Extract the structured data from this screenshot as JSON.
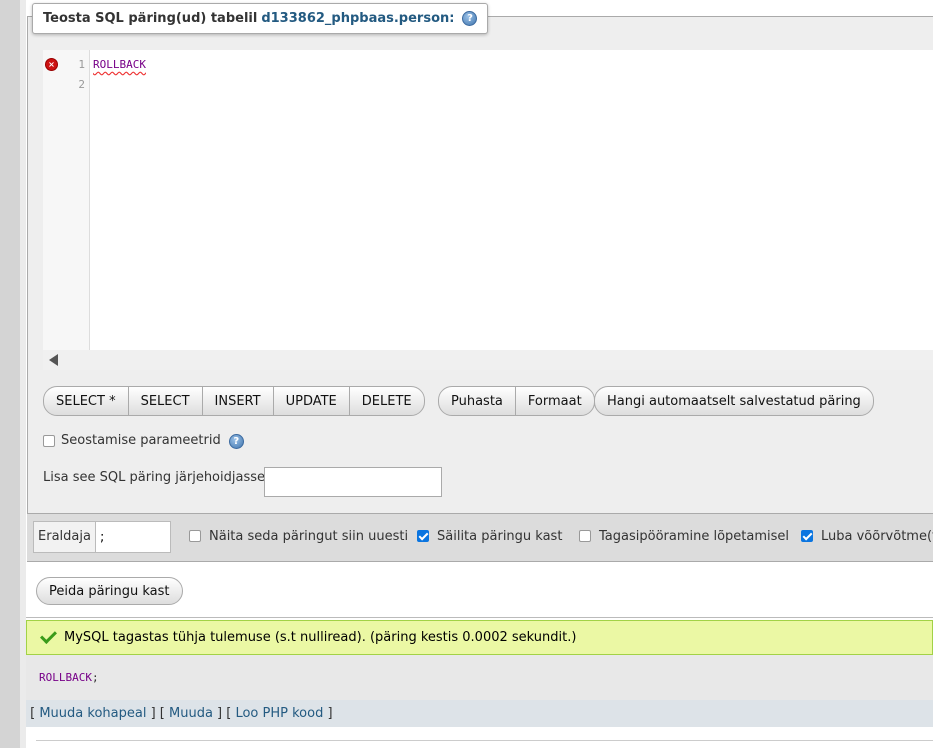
{
  "legend": {
    "prefix": "Teosta SQL päring(ud) tabelil",
    "table": "d133862_phpbaas.person:",
    "help": "?"
  },
  "editor": {
    "line_numbers": [
      "1",
      "2"
    ],
    "code": "ROLLBACK",
    "error_marker": "×"
  },
  "buttons": {
    "group1": [
      "SELECT *",
      "SELECT",
      "INSERT",
      "UPDATE",
      "DELETE"
    ],
    "group2": [
      "Puhasta",
      "Formaat"
    ],
    "autoload": "Hangi automaatselt salvestatud päring"
  },
  "bind_params": {
    "label": "Seostamise parameetrid",
    "checked": false
  },
  "bookmark": {
    "label": "Lisa see SQL päring järjehoidjasse:",
    "value": ""
  },
  "options": {
    "delimiter_label": "Eraldaja",
    "delimiter_value": ";",
    "show_again": {
      "label": "Näita seda päringut siin uuesti",
      "checked": false
    },
    "retain_box": {
      "label": "Säilita päringu kast",
      "checked": true
    },
    "rollback": {
      "label": "Tagasipööramine lõpetamisel",
      "checked": false
    },
    "foreign_keys": {
      "label": "Luba võõrvõtme(te)",
      "checked": true
    }
  },
  "hide_button": "Peida päringu kast",
  "result": {
    "message": "MySQL tagastas tühja tulemuse (s.t nulliread). (päring kestis 0.0002 sekundit.)",
    "query": "ROLLBACK",
    "query_terminator": ";"
  },
  "links": {
    "edit_inline": "Muuda kohapeal",
    "edit": "Muuda",
    "php_code": "Loo PHP kood"
  }
}
